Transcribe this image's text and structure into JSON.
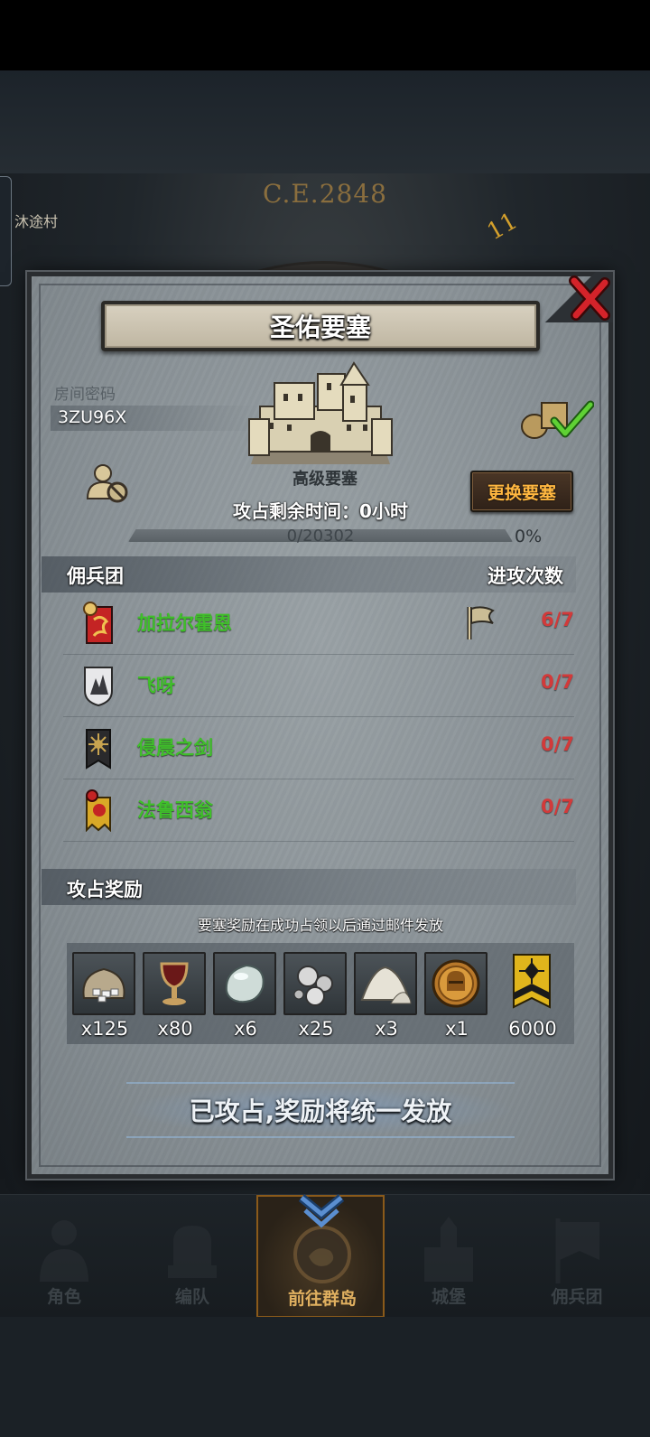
{
  "background": {
    "year": "C.E.2848",
    "village": "沐途村",
    "dial_number": "11"
  },
  "modal": {
    "title": "圣佑要塞",
    "room_label": "房间密码",
    "room_code": "3ZU96X",
    "fortress_grade": "高级要塞",
    "occupy_time_label": "攻占剩余时间：0小时",
    "change_button": "更换要塞",
    "progress": {
      "text": "0/20302",
      "percent_text": "0%",
      "value": 0
    },
    "mercenary_header": "佣兵团",
    "attacks_header": "进攻次数",
    "mercenaries": [
      {
        "name": "加拉尔霍恩",
        "attacks": "6/7",
        "flag": true
      },
      {
        "name": "飞呀",
        "attacks": "0/7",
        "flag": false
      },
      {
        "name": "侵晨之剑",
        "attacks": "0/7",
        "flag": false
      },
      {
        "name": "法鲁西翁",
        "attacks": "0/7",
        "flag": false
      }
    ],
    "reward_header": "攻占奖励",
    "reward_note": "要塞奖励在成功占领以后通过邮件发放",
    "rewards": [
      {
        "icon": "ore-sack-icon",
        "count": "x125"
      },
      {
        "icon": "goblet-icon",
        "count": "x80"
      },
      {
        "icon": "moonstone-icon",
        "count": "x6"
      },
      {
        "icon": "silver-pearls-icon",
        "count": "x25"
      },
      {
        "icon": "powder-pile-icon",
        "count": "x3"
      },
      {
        "icon": "helmet-coin-icon",
        "count": "x1"
      },
      {
        "icon": "guild-banner-icon",
        "count": "6000"
      }
    ],
    "status": "已攻占,奖励将统一发放"
  },
  "nav": [
    {
      "label": "角色",
      "icon": "character-icon"
    },
    {
      "label": "编队",
      "icon": "formation-icon"
    },
    {
      "label": "前往群岛",
      "icon": "islands-icon",
      "active": true
    },
    {
      "label": "城堡",
      "icon": "castle-icon"
    },
    {
      "label": "佣兵团",
      "icon": "mercenary-icon"
    }
  ],
  "colors": {
    "name_green": "#3fbf2a",
    "attack_red": "#d23a3a",
    "button_orange": "#ffb740",
    "panel_grey": "#8a9297"
  }
}
